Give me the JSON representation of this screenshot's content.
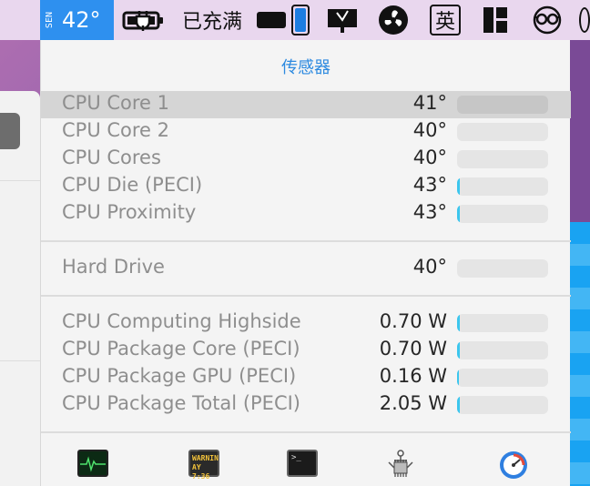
{
  "menubar": {
    "sensor_label": "SEN",
    "temperature": "42°",
    "battery_status": "已充满",
    "input_method": "英"
  },
  "panel": {
    "title": "传感器",
    "temperature_rows": [
      {
        "label": "CPU Core 1",
        "value": "41°",
        "level": 0.0
      },
      {
        "label": "CPU Core 2",
        "value": "40°",
        "level": 0.0
      },
      {
        "label": "CPU Cores",
        "value": "40°",
        "level": 0.0
      },
      {
        "label": "CPU Die (PECI)",
        "value": "43°",
        "level": 0.03
      },
      {
        "label": "CPU Proximity",
        "value": "43°",
        "level": 0.03
      }
    ],
    "drive_rows": [
      {
        "label": "Hard Drive",
        "value": "40°",
        "level": 0.0
      }
    ],
    "power_rows": [
      {
        "label": "CPU Computing Highside",
        "value": "0.70 W",
        "level": 0.03
      },
      {
        "label": "CPU Package Core (PECI)",
        "value": "0.70 W",
        "level": 0.03
      },
      {
        "label": "CPU Package GPU (PECI)",
        "value": "0.16 W",
        "level": 0.02
      },
      {
        "label": "CPU Package Total (PECI)",
        "value": "2.05 W",
        "level": 0.03
      }
    ],
    "footer_icons": [
      "activity-monitor-icon",
      "console-icon",
      "terminal-icon",
      "system-information-icon",
      "istat-menus-icon"
    ],
    "footer_console_text": [
      "WARNIN",
      "AY 7:36"
    ],
    "footer_terminal_text": ">_"
  },
  "colors": {
    "accent": "#2e90ef",
    "title": "#2d8ae0",
    "bar_fill": "#3bc6ee",
    "highlight_row": "#d5d5d5"
  }
}
